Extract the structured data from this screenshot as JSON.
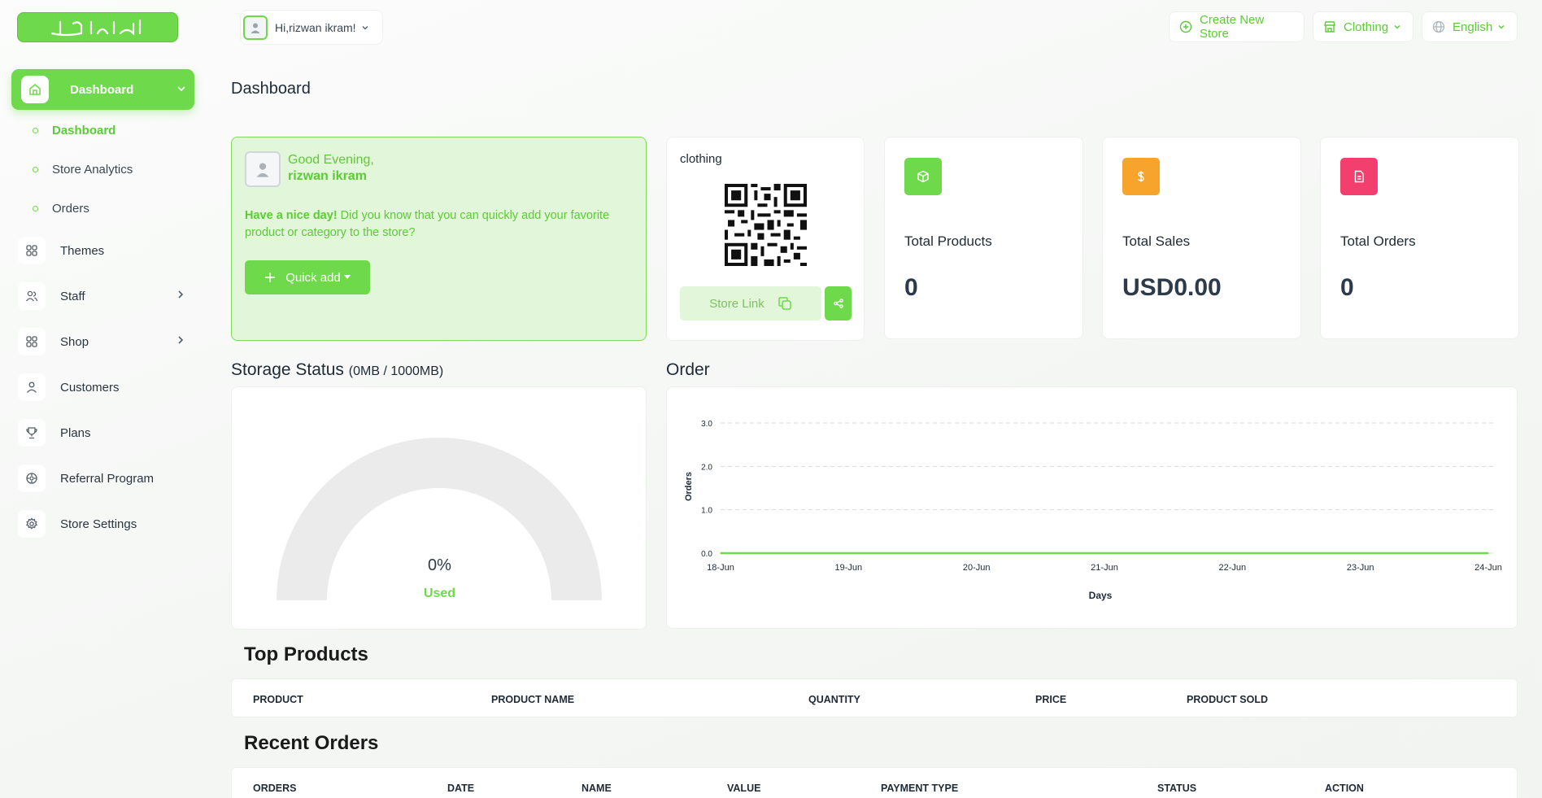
{
  "brand": {
    "logo_text": "اعرض",
    "accent": "#6fd94c"
  },
  "sidebar": {
    "dashboard_label": "Dashboard",
    "sub_items": [
      {
        "label": "Dashboard"
      },
      {
        "label": "Store Analytics"
      },
      {
        "label": "Orders"
      }
    ],
    "items": [
      {
        "label": "Themes",
        "icon": "grid-icon"
      },
      {
        "label": "Staff",
        "icon": "users-icon"
      },
      {
        "label": "Shop",
        "icon": "grid-icon"
      },
      {
        "label": "Customers",
        "icon": "user-icon"
      },
      {
        "label": "Plans",
        "icon": "trophy-icon"
      },
      {
        "label": "Referral Program",
        "icon": "referral-icon"
      },
      {
        "label": "Store Settings",
        "icon": "settings-icon"
      }
    ]
  },
  "header": {
    "greeting": "Hi,rizwan ikram!",
    "create_store": "Create New Store",
    "store": "Clothing",
    "language": "English"
  },
  "page_title": "Dashboard",
  "welcome": {
    "line1": "Good Evening,",
    "line2": "rizwan ikram",
    "nice_day": "Have a nice day!",
    "text": " Did you know that you can quickly add your favorite product or category to the store?",
    "quick_add": "Quick add"
  },
  "store_card": {
    "name": "clothing",
    "store_link": "Store Link"
  },
  "stats": [
    {
      "label": "Total Products",
      "value": "0",
      "color": "#6fd94c",
      "icon": "box-icon"
    },
    {
      "label": "Total Sales",
      "value": "USD0.00",
      "color": "#f7a42c",
      "icon": "dollar-icon"
    },
    {
      "label": "Total Orders",
      "value": "0",
      "color": "#f23f6e",
      "icon": "document-icon"
    }
  ],
  "storage": {
    "title": "Storage Status",
    "detail": "(0MB / 1000MB)",
    "percent": "0%",
    "used_label": "Used",
    "used_fraction": 0
  },
  "order_chart": {
    "title": "Order"
  },
  "chart_data": {
    "type": "line",
    "x": [
      "18-Jun",
      "19-Jun",
      "20-Jun",
      "21-Jun",
      "22-Jun",
      "23-Jun",
      "24-Jun"
    ],
    "series": [
      {
        "values": [
          0,
          0,
          0,
          0,
          0,
          0,
          0
        ]
      }
    ],
    "xlabel": "Days",
    "ylabel": "Orders",
    "ylim": [
      0,
      3
    ],
    "yticks": [
      "0.0",
      "1.0",
      "2.0",
      "3.0"
    ],
    "grid": true,
    "color": "#6fd94c"
  },
  "top_products": {
    "title": "Top Products",
    "columns": [
      "PRODUCT",
      "PRODUCT NAME",
      "QUANTITY",
      "PRICE",
      "PRODUCT SOLD"
    ]
  },
  "recent_orders": {
    "title": "Recent Orders",
    "columns": [
      "ORDERS",
      "DATE",
      "NAME",
      "VALUE",
      "PAYMENT TYPE",
      "STATUS",
      "ACTION"
    ]
  }
}
